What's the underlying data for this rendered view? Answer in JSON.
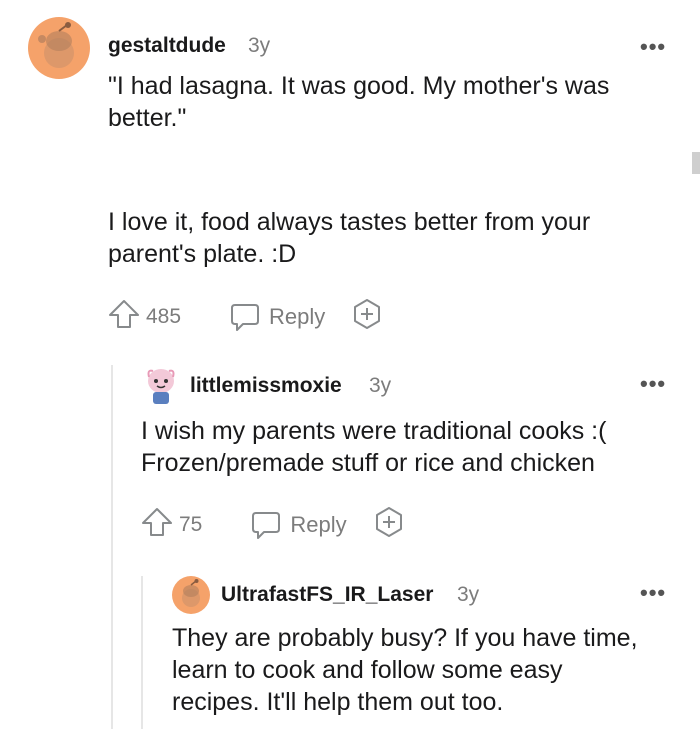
{
  "comments": [
    {
      "username": "gestaltdude",
      "age": "3y",
      "text_lines": [
        "\"I had lasagna. It was good. My mother's was",
        "better.\""
      ],
      "text2_lines": [
        "I love it, food always tastes better from your",
        "parent's plate. :D"
      ],
      "upvotes": "485",
      "reply_label": "Reply",
      "more_label": "•••",
      "avatar_color": "#f5a26a"
    },
    {
      "username": "littlemissmoxie",
      "age": "3y",
      "text_lines": [
        "I wish my parents were traditional cooks :(",
        "Frozen/premade stuff or rice and chicken"
      ],
      "upvotes": "75",
      "reply_label": "Reply",
      "more_label": "•••"
    },
    {
      "username": "UltrafastFS_IR_Laser",
      "age": "3y",
      "text_lines": [
        "They are probably busy? If you have time,",
        "learn to cook and follow some easy",
        "recipes. It'll help them out too."
      ],
      "more_label": "•••",
      "avatar_color": "#f5a26a"
    }
  ]
}
